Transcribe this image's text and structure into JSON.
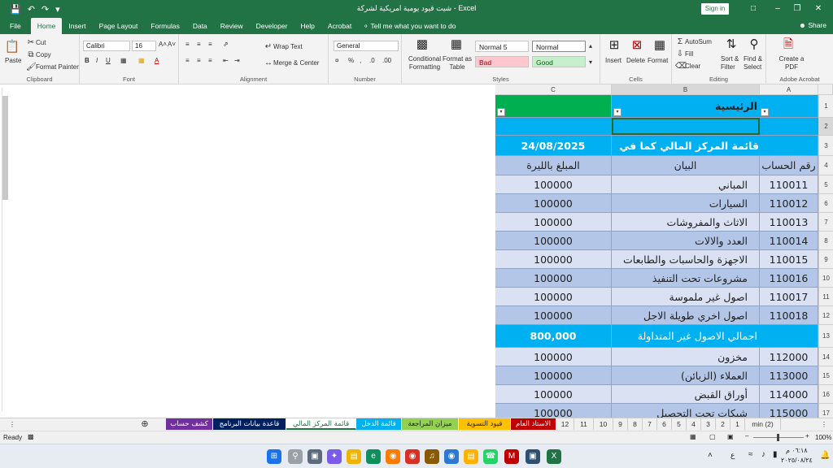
{
  "window": {
    "title": "شيت قيود يومية امريكية لشركة  -  Excel",
    "signin": "Sign in",
    "share": "Share"
  },
  "menu": {
    "tabs": [
      "File",
      "Home",
      "Insert",
      "Page Layout",
      "Formulas",
      "Data",
      "Review",
      "Developer",
      "Help",
      "Acrobat"
    ],
    "tellme": "Tell me what you want to do"
  },
  "ribbon": {
    "clipboard": {
      "label": "Clipboard",
      "paste": "Paste",
      "cut": "Cut",
      "copy": "Copy",
      "format_painter": "Format Painter"
    },
    "font": {
      "label": "Font",
      "name": "Calibri",
      "size": "16"
    },
    "alignment": {
      "label": "Alignment",
      "wrap": "Wrap Text",
      "merge": "Merge & Center"
    },
    "number": {
      "label": "Number",
      "format": "General"
    },
    "styles": {
      "label": "Styles",
      "conditional": "Conditional Formatting",
      "format_table": "Format as Table",
      "normal5": "Normal 5",
      "normal": "Normal",
      "bad": "Bad",
      "good": "Good"
    },
    "cells": {
      "label": "Cells",
      "insert": "Insert",
      "delete": "Delete",
      "format": "Format"
    },
    "editing": {
      "label": "Editing",
      "autosum": "AutoSum",
      "fill": "Fill",
      "clear": "Clear",
      "sort": "Sort & Filter",
      "find": "Find & Select"
    },
    "acrobat": {
      "label": "Adobe Acrobat",
      "create": "Create a PDF"
    }
  },
  "sheet": {
    "columns": [
      "C",
      "B",
      "A"
    ],
    "header_title": "الرئيسية",
    "report_title": "قائمة المركز المالي كما في",
    "report_date": "24/08/2025",
    "col_account": "رقم الحساب",
    "col_desc": "البيان",
    "col_amount": "المبلغ بالليرة",
    "rows_group1": [
      {
        "row": "5",
        "account": "110011",
        "desc": "المباني",
        "amount": "100000"
      },
      {
        "row": "6",
        "account": "110012",
        "desc": "السيارات",
        "amount": "100000"
      },
      {
        "row": "7",
        "account": "110013",
        "desc": "الاثاث والمفروشات",
        "amount": "100000"
      },
      {
        "row": "8",
        "account": "110014",
        "desc": "العدد والالات",
        "amount": "100000"
      },
      {
        "row": "9",
        "account": "110015",
        "desc": "الاجهزة والحاسبات والطابعات",
        "amount": "100000"
      },
      {
        "row": "10",
        "account": "110016",
        "desc": "مشروعات تحت التنفيذ",
        "amount": "100000"
      },
      {
        "row": "11",
        "account": "110017",
        "desc": "اصول غير ملموسة",
        "amount": "100000"
      },
      {
        "row": "12",
        "account": "110018",
        "desc": "اصول اخري طويلة الاجل",
        "amount": "100000"
      }
    ],
    "subtotal_label": "اجمالي الاصول غير المتداولة",
    "subtotal_value": "800,000",
    "rows_group2": [
      {
        "row": "14",
        "account": "112000",
        "desc": "مخزون",
        "amount": "100000"
      },
      {
        "row": "15",
        "account": "113000",
        "desc": "العملاء (الزبائن)",
        "amount": "100000"
      },
      {
        "row": "16",
        "account": "114000",
        "desc": "أوراق القبض",
        "amount": "100000"
      },
      {
        "row": "17",
        "account": "115000",
        "desc": "شيكات تحت التحصيل",
        "amount": "100000"
      }
    ]
  },
  "sheet_tabs": [
    {
      "name": "كشف حساب",
      "color": "#7030a0"
    },
    {
      "name": "قاعدة بيانات البرنامج",
      "color": "#002060"
    },
    {
      "name": "قائمة المركز المالي",
      "color": "#ffffff",
      "active": true
    },
    {
      "name": "قائمة الدخل",
      "color": "#00b0f0"
    },
    {
      "name": "ميزان المراجعة",
      "color": "#92d050"
    },
    {
      "name": "قيود التسوية",
      "color": "#ffc000"
    },
    {
      "name": "الاستاذ العام",
      "color": "#c00000"
    }
  ],
  "number_tabs": [
    "12",
    "11",
    "10",
    "9",
    "8",
    "7",
    "6",
    "5",
    "4",
    "3",
    "2",
    "1",
    "min (2)"
  ],
  "status": {
    "ready": "Ready",
    "zoom": "100%"
  },
  "taskbar": {
    "time": "٠٦:١٨ م",
    "date": "٢٠٢٥/٠٨/٢٤",
    "lang": "ع"
  }
}
